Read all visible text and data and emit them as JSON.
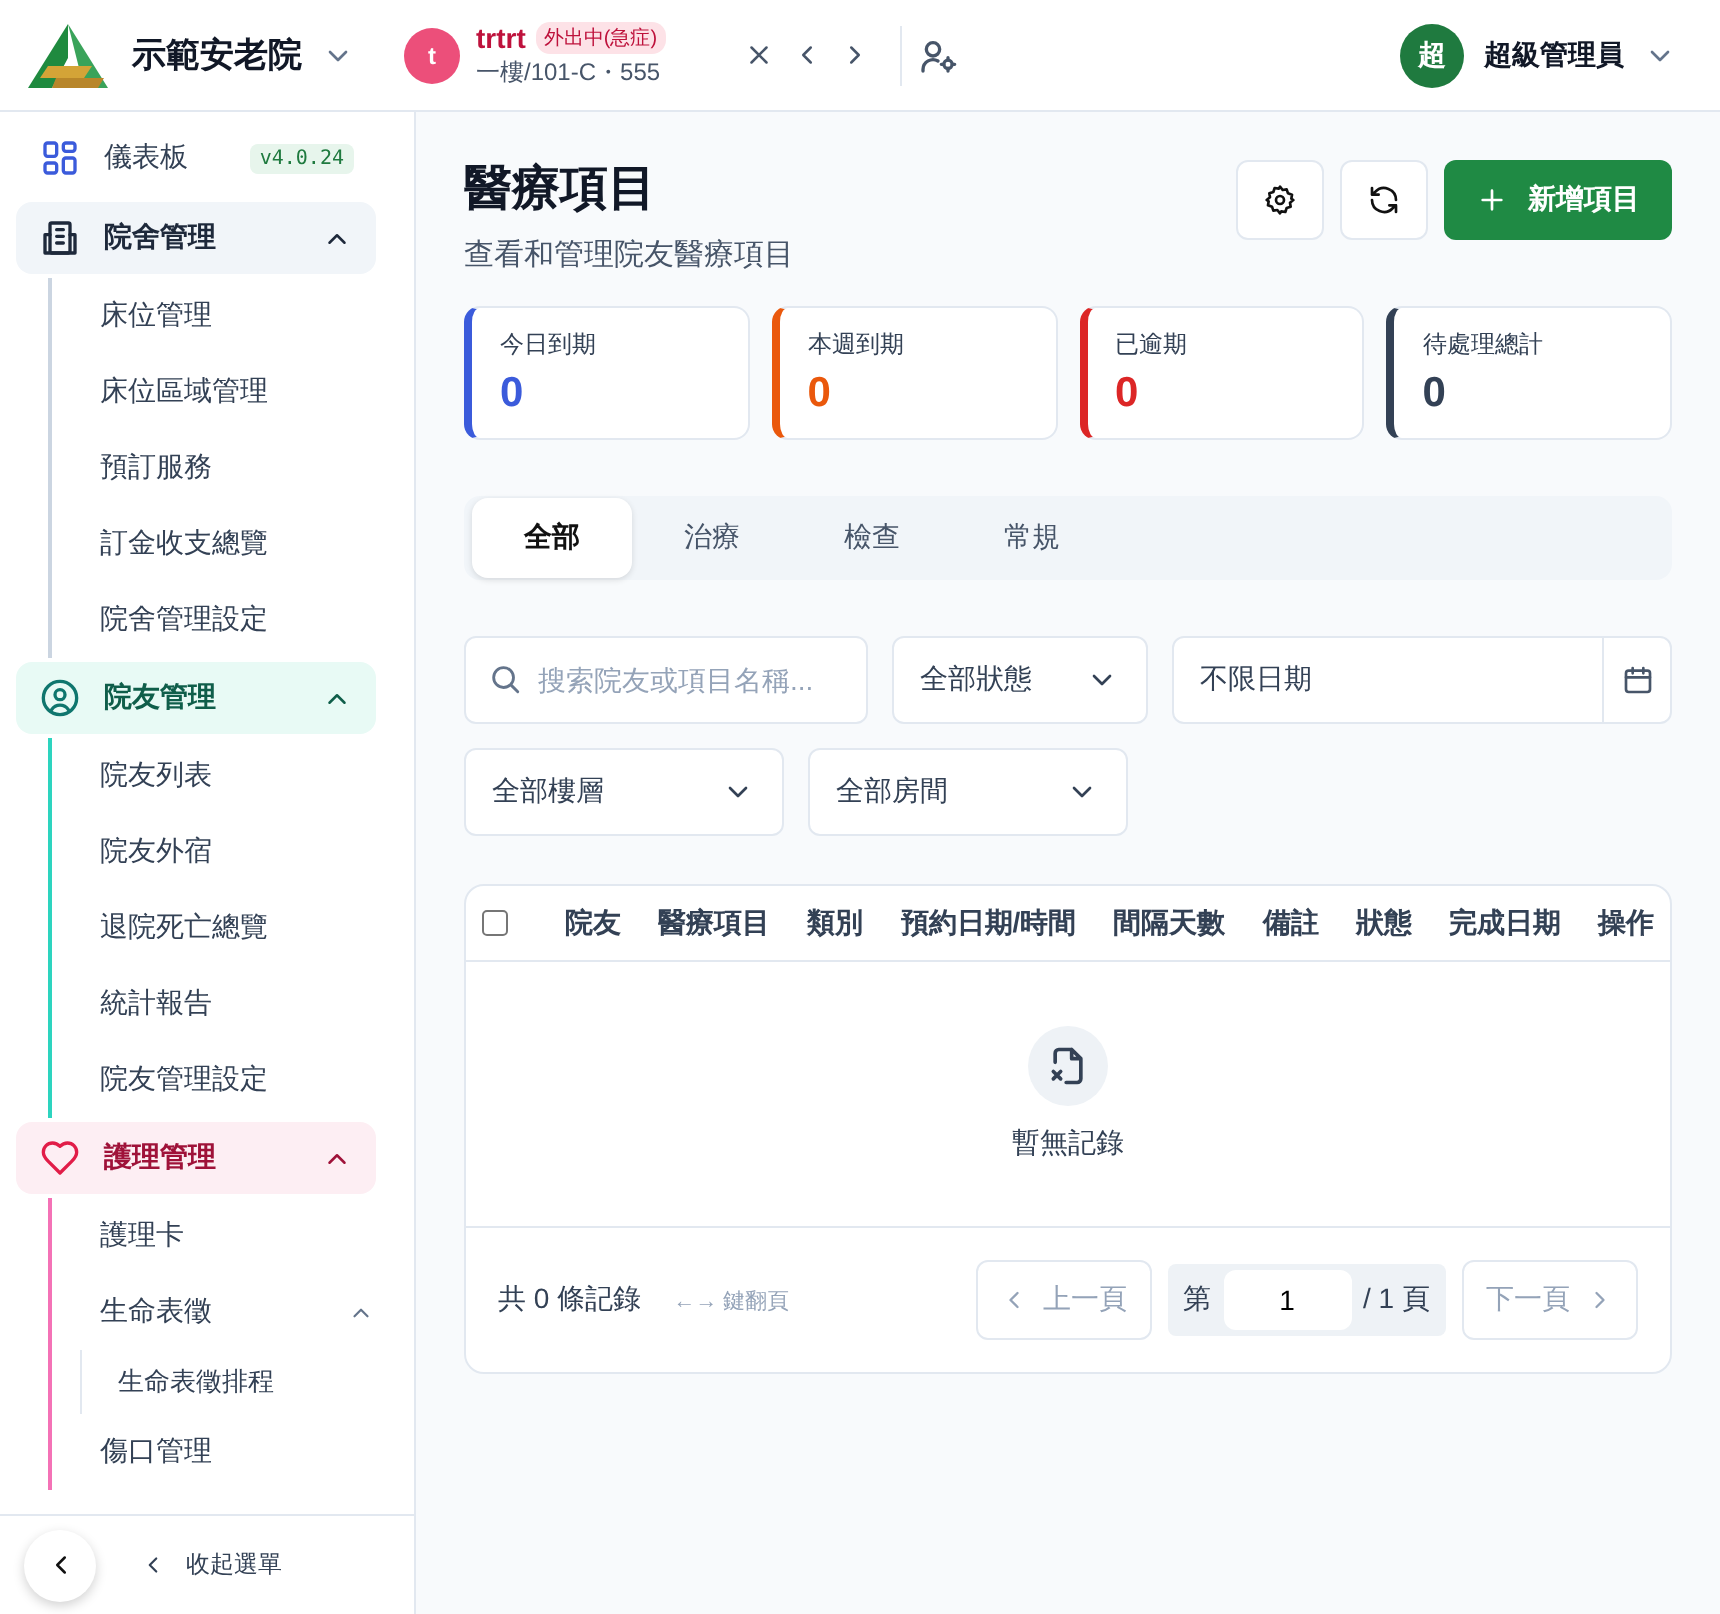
{
  "header": {
    "org_name": "示範安老院",
    "patient": {
      "avatar": "t",
      "name": "trtrt",
      "badge": "外出中(急症)",
      "location": "一樓/101-C・555"
    },
    "user": {
      "avatar": "超",
      "name": "超級管理員"
    }
  },
  "sidebar": {
    "dashboard": {
      "label": "儀表板",
      "version": "v4.0.24"
    },
    "groups": [
      {
        "label": "院舍管理",
        "kind": "building",
        "color": "#cbd5e1",
        "expanded": true,
        "items": [
          {
            "label": "床位管理"
          },
          {
            "label": "床位區域管理"
          },
          {
            "label": "預訂服務"
          },
          {
            "label": "訂金收支總覽"
          },
          {
            "label": "院舍管理設定"
          }
        ]
      },
      {
        "label": "院友管理",
        "kind": "person",
        "color": "#2dd4bf",
        "expanded": true,
        "items": [
          {
            "label": "院友列表"
          },
          {
            "label": "院友外宿"
          },
          {
            "label": "退院死亡總覽"
          },
          {
            "label": "統計報告"
          },
          {
            "label": "院友管理設定"
          }
        ]
      },
      {
        "label": "護理管理",
        "kind": "heart",
        "color": "#f472b6",
        "expanded": true,
        "items": [
          {
            "label": "護理卡"
          },
          {
            "label": "生命表徵",
            "expanded": true,
            "children": [
              {
                "label": "生命表徵排程"
              }
            ]
          },
          {
            "label": "傷口管理"
          }
        ]
      }
    ],
    "collapse": "收起選單"
  },
  "page": {
    "title": "醫療項目",
    "subtitle": "查看和管理院友醫療項目",
    "add_button": "新增項目"
  },
  "stats": [
    {
      "label": "今日到期",
      "value": "0",
      "color": "#3b5bdb"
    },
    {
      "label": "本週到期",
      "value": "0",
      "color": "#ea580c"
    },
    {
      "label": "已逾期",
      "value": "0",
      "color": "#dc2626"
    },
    {
      "label": "待處理總計",
      "value": "0",
      "color": "#334155"
    }
  ],
  "tabs": [
    {
      "label": "全部",
      "selected": true
    },
    {
      "label": "治療",
      "selected": false
    },
    {
      "label": "檢查",
      "selected": false
    },
    {
      "label": "常規",
      "selected": false
    }
  ],
  "filters": {
    "search": {
      "placeholder": "搜索院友或項目名稱..."
    },
    "status": "全部狀態",
    "date": "不限日期",
    "floor": "全部樓層",
    "room": "全部房間"
  },
  "table": {
    "select_all": false,
    "columns": [
      "院友",
      "醫療項目",
      "類別",
      "預約日期/時間",
      "間隔天數",
      "備註",
      "狀態",
      "完成日期",
      "操作"
    ],
    "empty": "暫無記錄"
  },
  "pagination": {
    "total": "共 0 條記錄",
    "hint": "←→ 鍵翻頁",
    "prev": {
      "label": "上一頁",
      "disabled": true
    },
    "page_prefix": "第",
    "page_value": "1",
    "page_suffix": "/ 1 頁",
    "next": {
      "label": "下一頁",
      "disabled": true
    }
  }
}
